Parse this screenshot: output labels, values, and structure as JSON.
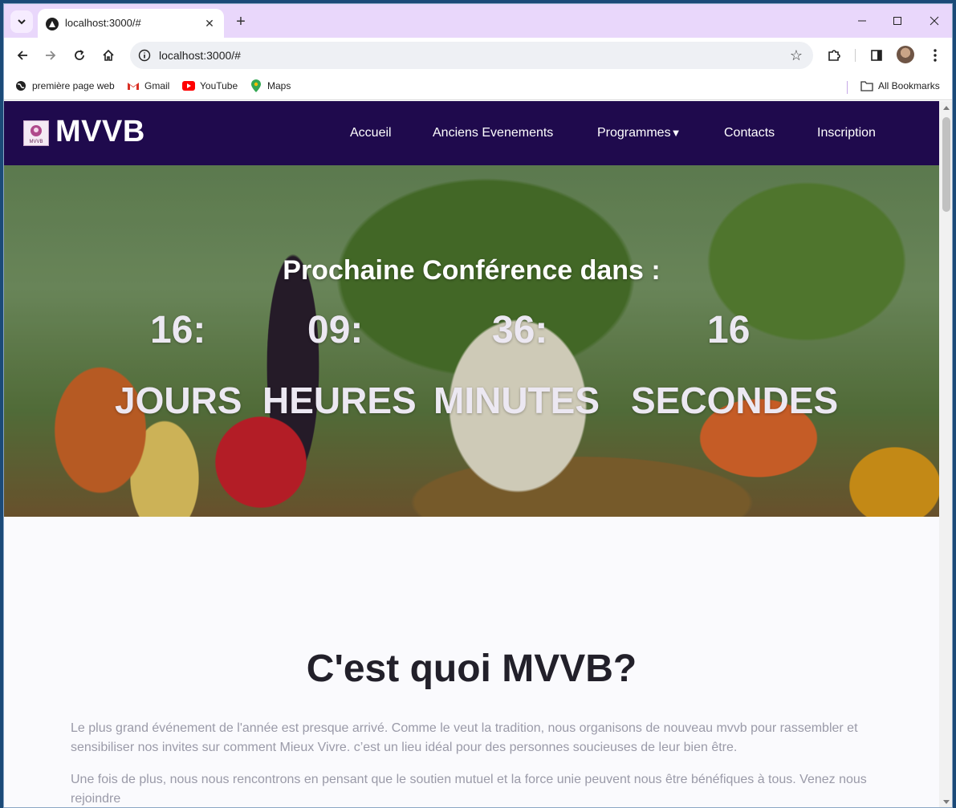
{
  "browser": {
    "tab_title": "localhost:3000/#",
    "url": "localhost:3000/#",
    "bookmarks": [
      {
        "label": "première page web",
        "icon": "globe-icon"
      },
      {
        "label": "Gmail",
        "icon": "gmail-icon"
      },
      {
        "label": "YouTube",
        "icon": "youtube-icon"
      },
      {
        "label": "Maps",
        "icon": "maps-icon"
      }
    ],
    "all_bookmarks": "All Bookmarks"
  },
  "site": {
    "logo_text": "MVVB",
    "logo_small": "MVVB",
    "nav": [
      {
        "label": "Accueil"
      },
      {
        "label": "Anciens Evenements"
      },
      {
        "label": "Programmes"
      },
      {
        "label": "Contacts"
      },
      {
        "label": "Inscription"
      }
    ],
    "programmes_caret": "▼"
  },
  "hero": {
    "title": "Prochaine Conférence dans :",
    "countdown": [
      {
        "value": "16:",
        "label": "JOURS"
      },
      {
        "value": "09:",
        "label": "HEURES"
      },
      {
        "value": "36:",
        "label": "MINUTES"
      },
      {
        "value": "16",
        "label": "SECONDES"
      }
    ]
  },
  "about": {
    "title": "C'est quoi MVVB?",
    "paragraphs": [
      "Le plus grand événement de l'année est presque arrivé. Comme le veut la tradition, nous organisons de nouveau mvvb pour rassembler et sensibiliser nos invites sur comment Mieux Vivre. c’est un lieu idéal pour des personnes soucieuses de leur bien être.",
      "Une fois de plus, nous nous rencontrons en pensant que le soutien mutuel et la force unie peuvent nous être bénéfiques à tous. Venez nous rejoindre"
    ]
  },
  "colors": {
    "nav_bg": "#1f0a4d",
    "tabstrip_bg": "#e9d7fb",
    "page_bg": "#fafafd"
  }
}
